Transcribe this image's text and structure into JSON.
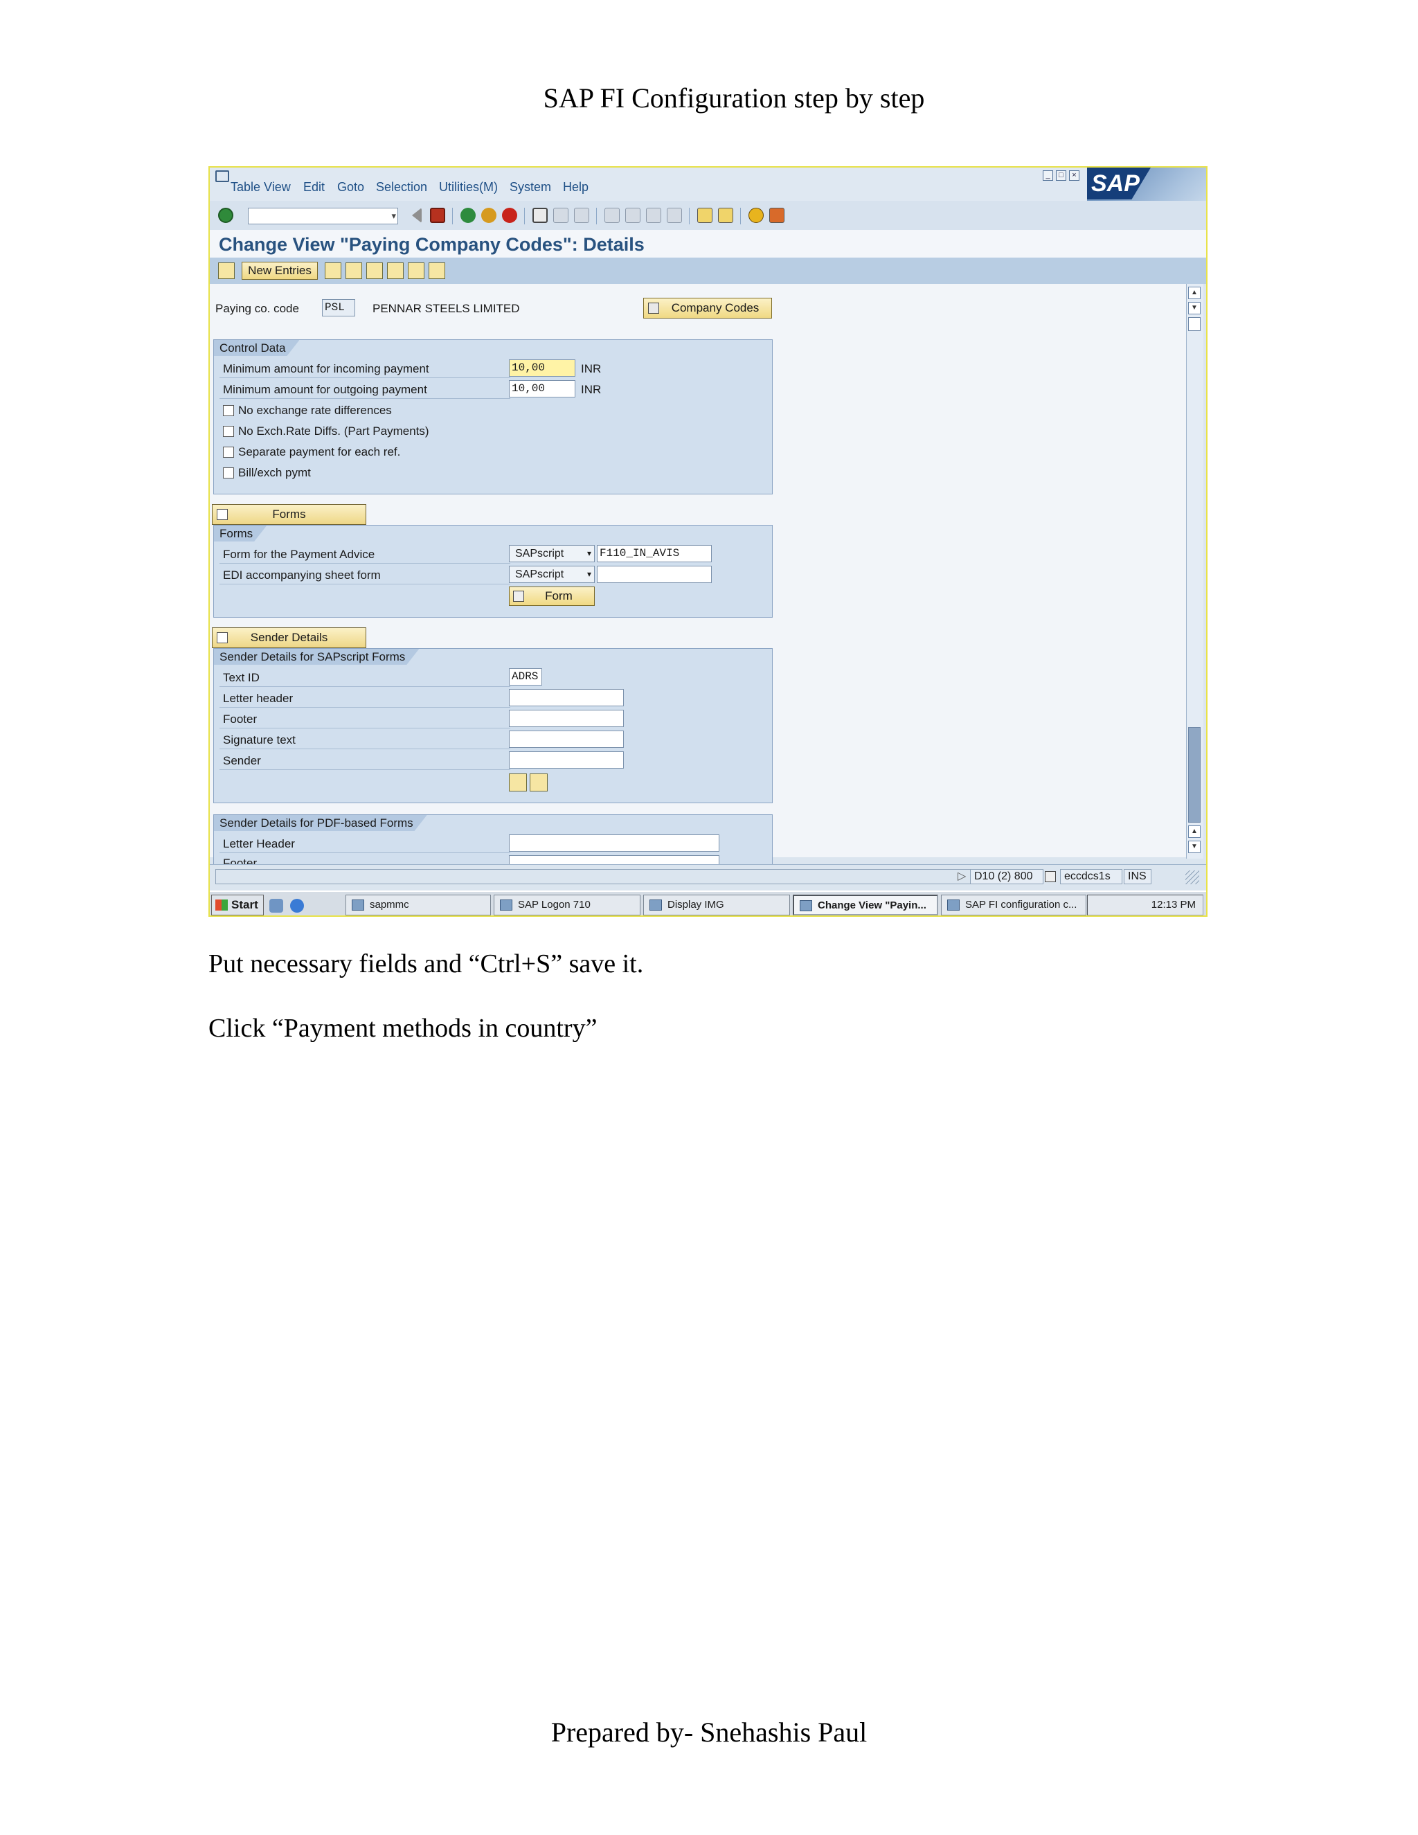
{
  "document": {
    "title": "SAP FI Configuration step by step",
    "instruction_1": "Put necessary fields and “Ctrl+S” save it.",
    "instruction_2": "Click “Payment methods in country”",
    "footer": "Prepared by- Snehashis Paul"
  },
  "sap": {
    "menu": [
      "Table View",
      "Edit",
      "Goto",
      "Selection",
      "Utilities(M)",
      "System",
      "Help"
    ],
    "screen_title": "Change View \"Paying Company Codes\": Details",
    "new_entries_label": "New Entries",
    "paying_co_code_label": "Paying co. code",
    "paying_co_code_value": "PSL",
    "company_name": "PENNAR STEELS LIMITED",
    "company_codes_button": "Company Codes",
    "control_data": {
      "title": "Control Data",
      "min_incoming_label": "Minimum amount for incoming payment",
      "min_incoming_value": "10,00",
      "min_incoming_currency": "INR",
      "min_outgoing_label": "Minimum amount for outgoing payment",
      "min_outgoing_value": "10,00",
      "min_outgoing_currency": "INR",
      "checkboxes": [
        "No exchange rate differences",
        "No Exch.Rate Diffs. (Part Payments)",
        "Separate payment for each ref.",
        "Bill/exch pymt"
      ]
    },
    "forms": {
      "tab_label": "Forms",
      "title": "Forms",
      "payment_advice_label": "Form for the Payment Advice",
      "payment_advice_type": "SAPscript",
      "payment_advice_value": "F110_IN_AVIS",
      "edi_label": "EDI accompanying sheet form",
      "edi_type": "SAPscript",
      "edi_value": "",
      "form_button": "Form"
    },
    "sender": {
      "tab_label": "Sender Details",
      "sapscript_title": "Sender Details for SAPscript Forms",
      "text_id_label": "Text ID",
      "text_id_value": "ADRS",
      "letter_header_label": "Letter header",
      "footer_label": "Footer",
      "signature_label": "Signature text",
      "sender_label": "Sender",
      "pdf_title": "Sender Details for PDF-based Forms",
      "pdf_letter_header_label": "Letter Header",
      "pdf_footer_label": "Footer"
    },
    "status": {
      "system": "D10 (2) 800",
      "server": "eccdcs1s",
      "mode": "INS"
    },
    "taskbar": {
      "start": "Start",
      "tasks": [
        "sapmmc",
        "SAP Logon 710",
        "Display IMG",
        "Change View \"Payin...",
        "SAP FI configuration c..."
      ],
      "clock": "12:13 PM"
    },
    "logo_text": "SAP"
  }
}
